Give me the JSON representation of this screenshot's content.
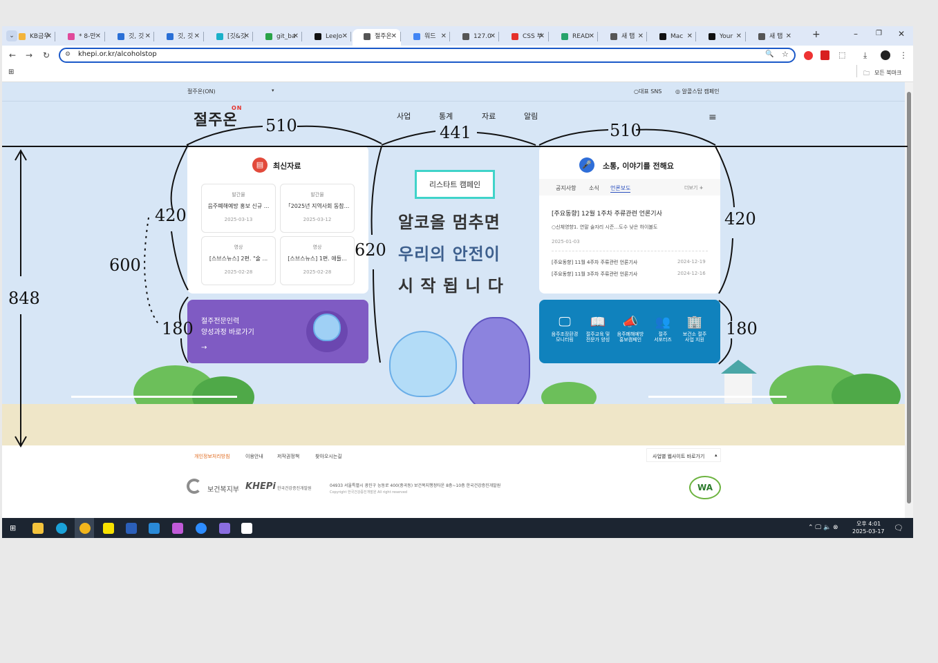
{
  "tabs": [
    {
      "label": "KB금우",
      "color": "#f3b43c"
    },
    {
      "label": "* 8-만",
      "color": "#e04a9b"
    },
    {
      "label": "깃, 깃",
      "color": "#2a6fd6"
    },
    {
      "label": "깃, 깃",
      "color": "#2a6fd6"
    },
    {
      "label": "[깃&깃",
      "color": "#1ab0c9"
    },
    {
      "label": "git_ba",
      "color": "#2aa348"
    },
    {
      "label": "LeeJo",
      "color": "#111111"
    },
    {
      "label": "절주온",
      "color": "#555555"
    },
    {
      "label": "워드",
      "color": "#4285f4"
    },
    {
      "label": "127.0",
      "color": "#555555"
    },
    {
      "label": "CSS 부",
      "color": "#e5312b"
    },
    {
      "label": "READ",
      "color": "#27a36b"
    },
    {
      "label": "새 탭",
      "color": "#555555"
    },
    {
      "label": "Mac",
      "color": "#111111"
    },
    {
      "label": "Your",
      "color": "#111111"
    },
    {
      "label": "새 탭",
      "color": "#555555"
    }
  ],
  "browser": {
    "new_tab": "+",
    "url": "khepi.or.kr/alcoholstop",
    "bookmarks_all": "모든 북마크"
  },
  "site": {
    "top_select": "절주온(ON)",
    "top_sns": "대표 SNS",
    "top_campaign": "알콜스탑 캠페인",
    "logo": "절주온",
    "logo_on": "ON",
    "nav": [
      "사업",
      "통계",
      "자료",
      "알림"
    ],
    "latest": {
      "title": "최신자료",
      "items": [
        {
          "cat": "발간물",
          "title": "음주폐해예방 홍보 신규 ...",
          "date": "2025-03-13"
        },
        {
          "cat": "발간물",
          "title": "「2025년 지역사회 동참...",
          "date": "2025-03-12"
        },
        {
          "cat": "영상",
          "title": "[스브스뉴스] 2편. \"술 ...",
          "date": "2025-02-28"
        },
        {
          "cat": "영상",
          "title": "[스브스뉴스] 1편. 애들...",
          "date": "2025-02-28"
        }
      ]
    },
    "purple_box": {
      "line1": "절주전문인력",
      "line2": "양성과정 바로가기",
      "arrow": "→"
    },
    "banner": {
      "badge": "리스타트 캠페인",
      "line1": "알코올 멈추면",
      "line2": "우리의 안전이",
      "line3": "시 작 됩 니 다"
    },
    "news": {
      "title": "소통, 이야기를 전해요",
      "tabs": [
        "공지사항",
        "소식",
        "언론보도"
      ],
      "more": "더보기",
      "headline": "[주요동향] 12월 1주차 주류관련 언론기사",
      "summary": "○신체영향1. 연말 술자리 시즌…도수 낮은 하이볼도",
      "headline_date": "2025-01-03",
      "items": [
        {
          "title": "[주요동향] 11월 4주차 주류관련 언론기사",
          "date": "2024-12-19"
        },
        {
          "title": "[주요동향] 11월 3주차 주류관련 언론기사",
          "date": "2024-12-16"
        }
      ]
    },
    "services": [
      {
        "l1": "음주조장환경",
        "l2": "모니터링",
        "icon": "🖵"
      },
      {
        "l1": "절주교육 및",
        "l2": "전문가 양성",
        "icon": "📖"
      },
      {
        "l1": "음주폐해예방",
        "l2": "홍보캠페인",
        "icon": "📣"
      },
      {
        "l1": "절주",
        "l2": "서포터즈",
        "icon": "👥"
      },
      {
        "l1": "보건소 절주",
        "l2": "사업 지원",
        "icon": "🏢"
      }
    ],
    "footer": {
      "links": [
        "개인정보처리방침",
        "이용안내",
        "저작권정책",
        "찾아오시는길"
      ],
      "sites": "사업별 웹사이트 바로가기",
      "org1": "보건복지부",
      "org2": "KHEPi",
      "org2_sub": "한국건강증진개발원",
      "address": "04933 서울특별시 광진구 능동로 400(중곡동) 보건복지행정타운 8층~10층 한국건강증진개발원",
      "copyright": "Copyright 한국건강증진개발원 All right reserved",
      "wa": "WA"
    }
  },
  "taskbar": {
    "time": "오후 4:01",
    "date": "2025-03-17"
  },
  "annotations": {
    "w_left": "510",
    "w_mid": "441",
    "w_right": "510",
    "h_left_top": "420",
    "h_left_bot": "180",
    "h_right_top": "420",
    "h_right_bot": "180",
    "h_mid": "620",
    "h_600": "600",
    "h_total": "848"
  }
}
